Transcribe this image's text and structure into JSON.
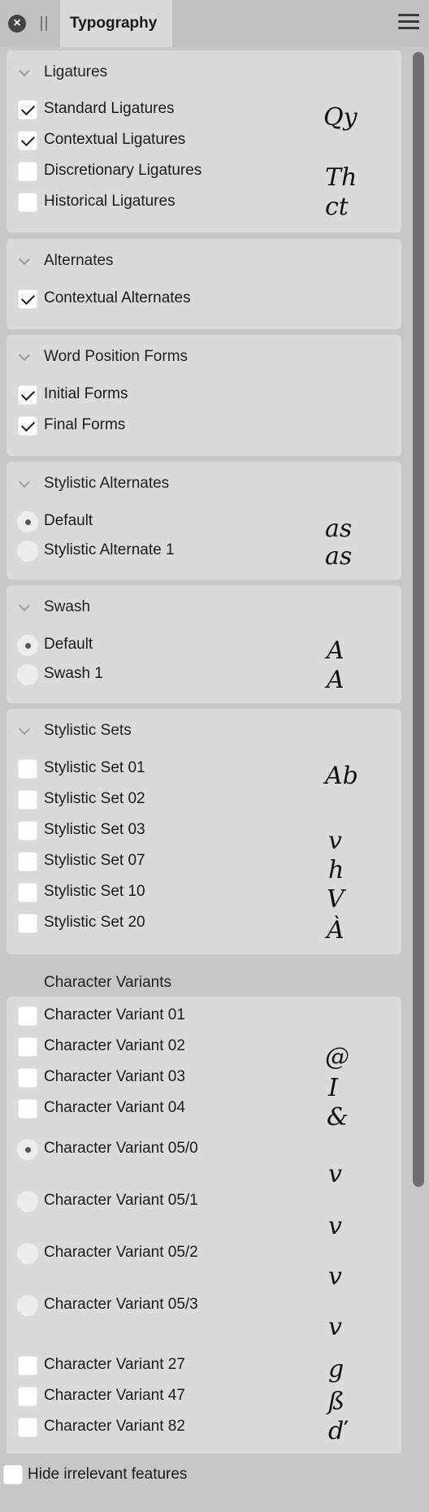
{
  "window": {
    "tab_title": "Typography"
  },
  "sections": {
    "ligatures": {
      "title": "Ligatures",
      "items": [
        {
          "label": "Standard Ligatures",
          "checked": true
        },
        {
          "label": "Contextual Ligatures",
          "checked": true
        },
        {
          "label": "Discretionary Ligatures",
          "checked": false
        },
        {
          "label": "Historical Ligatures",
          "checked": false
        }
      ],
      "glyphs": [
        "Qy",
        "Th",
        "ct"
      ]
    },
    "alternates": {
      "title": "Alternates",
      "items": [
        {
          "label": "Contextual Alternates",
          "checked": true
        }
      ]
    },
    "word_position": {
      "title": "Word Position Forms",
      "items": [
        {
          "label": "Initial Forms",
          "checked": true
        },
        {
          "label": "Final Forms",
          "checked": true
        }
      ]
    },
    "stylistic_alternates": {
      "title": "Stylistic Alternates",
      "items": [
        {
          "label": "Default",
          "selected": true
        },
        {
          "label": "Stylistic Alternate 1",
          "selected": false
        }
      ],
      "glyphs": [
        "as",
        "as"
      ]
    },
    "swash": {
      "title": "Swash",
      "items": [
        {
          "label": "Default",
          "selected": true
        },
        {
          "label": "Swash 1",
          "selected": false
        }
      ],
      "glyphs": [
        "A",
        "A"
      ]
    },
    "stylistic_sets": {
      "title": "Stylistic Sets",
      "items": [
        {
          "label": "Stylistic Set 01",
          "checked": false
        },
        {
          "label": "Stylistic Set 02",
          "checked": false
        },
        {
          "label": "Stylistic Set 03",
          "checked": false
        },
        {
          "label": "Stylistic Set 07",
          "checked": false
        },
        {
          "label": "Stylistic Set 10",
          "checked": false
        },
        {
          "label": "Stylistic Set 20",
          "checked": false
        }
      ],
      "glyphs": [
        "Ab",
        "v",
        "h",
        "V",
        "À"
      ]
    },
    "character_variants": {
      "title": "Character Variants",
      "items": [
        {
          "label": "Character Variant 01",
          "checked": false
        },
        {
          "label": "Character Variant 02",
          "checked": false
        },
        {
          "label": "Character Variant 03",
          "checked": false
        },
        {
          "label": "Character Variant 04",
          "checked": false
        },
        {
          "label": "Character Variant 05/0",
          "selected": true
        },
        {
          "label": "Character Variant 05/1",
          "selected": false
        },
        {
          "label": "Character Variant 05/2",
          "selected": false
        },
        {
          "label": "Character Variant 05/3",
          "selected": false
        },
        {
          "label": "Character Variant 27",
          "checked": false
        },
        {
          "label": "Character Variant 47",
          "checked": false
        },
        {
          "label": "Character Variant 82",
          "checked": false
        }
      ],
      "glyphs": [
        "@",
        "I",
        "&",
        "v",
        "v",
        "v",
        "v",
        "g",
        "ß",
        "ď"
      ]
    }
  },
  "footer": {
    "hide_irrelevant_label": "Hide irrelevant features",
    "hide_irrelevant_checked": false
  },
  "icons": {
    "close": "close-icon",
    "grip": "grip-icon",
    "menu": "hamburger-menu-icon",
    "chevron": "chevron-down-icon"
  }
}
